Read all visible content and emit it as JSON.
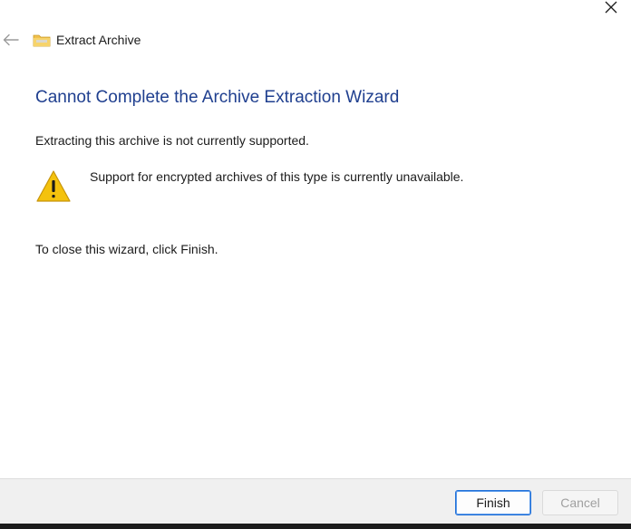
{
  "window": {
    "title": "Extract Archive",
    "close_icon": "close-icon",
    "back_icon": "back-arrow-icon",
    "app_icon": "folder-zip-icon"
  },
  "wizard": {
    "heading": "Cannot Complete the Archive Extraction Wizard",
    "message": "Extracting this archive is not currently supported.",
    "warning_icon": "warning-icon",
    "warning_text": "Support for encrypted archives of this type is currently unavailable.",
    "close_instruction": "To close this wizard, click Finish."
  },
  "footer": {
    "finish_label": "Finish",
    "cancel_label": "Cancel"
  },
  "colors": {
    "heading": "#1f3f8f",
    "accent": "#1f6fd8",
    "warning": "#f4c20d"
  }
}
